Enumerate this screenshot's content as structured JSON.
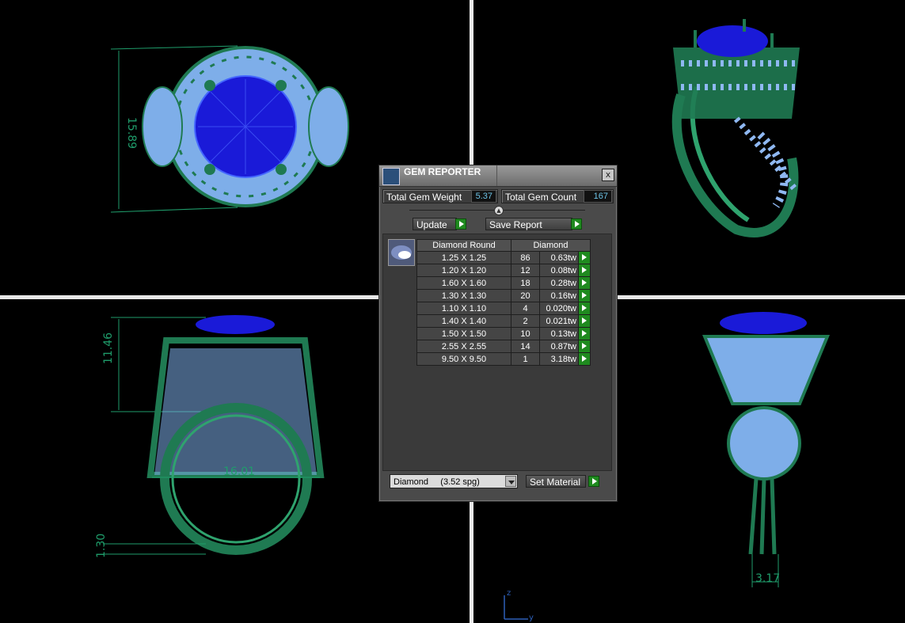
{
  "panel": {
    "title": "GEM REPORTER",
    "close_label": "x",
    "total_weight_label": "Total Gem Weight",
    "total_weight_value": "5.37",
    "total_count_label": "Total Gem Count",
    "total_count_value": "167",
    "update_label": "Update",
    "save_report_label": "Save Report",
    "gem_header_shape": "Diamond Round",
    "gem_header_material": "Diamond",
    "gems": [
      {
        "size": "1.25 X 1.25",
        "count": "86",
        "weight": "0.63tw"
      },
      {
        "size": "1.20 X 1.20",
        "count": "12",
        "weight": "0.08tw"
      },
      {
        "size": "1.60 X 1.60",
        "count": "18",
        "weight": "0.28tw"
      },
      {
        "size": "1.30 X 1.30",
        "count": "20",
        "weight": "0.16tw"
      },
      {
        "size": "1.10 X 1.10",
        "count": "4",
        "weight": "0.020tw"
      },
      {
        "size": "1.40 X 1.40",
        "count": "2",
        "weight": "0.021tw"
      },
      {
        "size": "1.50 X 1.50",
        "count": "10",
        "weight": "0.13tw"
      },
      {
        "size": "2.55 X 2.55",
        "count": "14",
        "weight": "0.87tw"
      },
      {
        "size": "9.50 X 9.50",
        "count": "1",
        "weight": "3.18tw"
      }
    ],
    "material_select": "Diamond     (3.52 spg)",
    "set_material_label": "Set Material"
  },
  "viewports": {
    "top_dim": "15.89",
    "front_height_dim": "11.46",
    "front_width_dim": "16.01",
    "front_band_dim": "1.30",
    "side_dim": "3.17",
    "axis_z": "z",
    "axis_y": "y"
  },
  "colors": {
    "metal": "#1f7a52",
    "metal_light": "#2fa36e",
    "gem_center": "#1a1ad8",
    "gem_accent": "#8fb8f2",
    "dimension": "#1f9d6b",
    "background": "#000000"
  }
}
